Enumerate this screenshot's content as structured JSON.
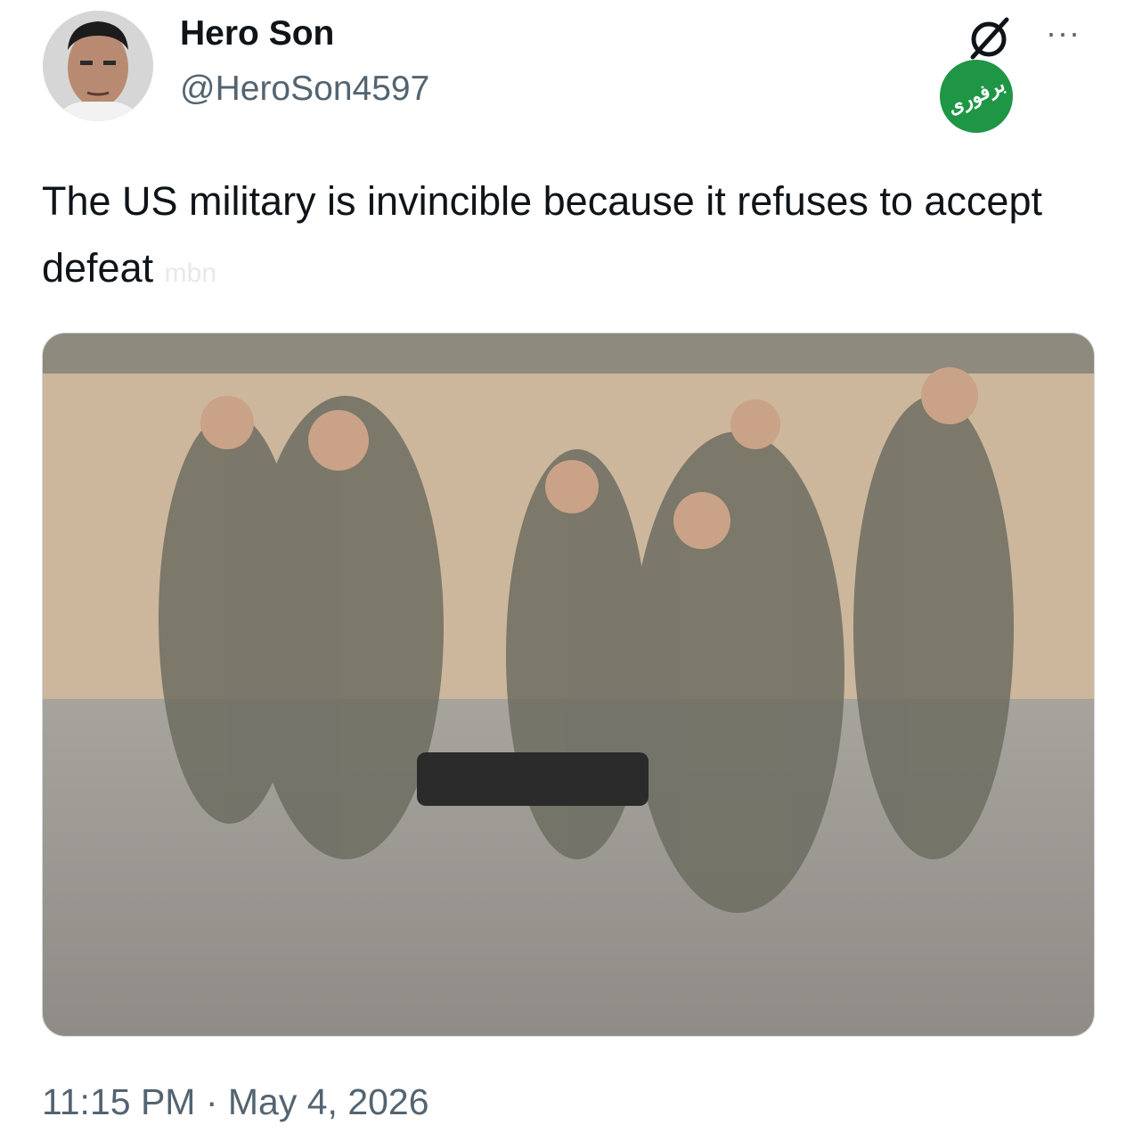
{
  "post": {
    "author_name": "Hero Son",
    "author_handle": "@HeroSon4597",
    "text": "The US military is invincible because it refuses to accept defeat",
    "text_watermark": "mbn",
    "timestamp": "11:15 PM · May 4, 2026"
  },
  "icons": {
    "x_logo": "x-logo-icon",
    "more": "more-options-icon",
    "more_glyph": "···"
  },
  "colors": {
    "text": "#0f1419",
    "secondary": "#536471",
    "watermark_green": "#1e9645"
  }
}
